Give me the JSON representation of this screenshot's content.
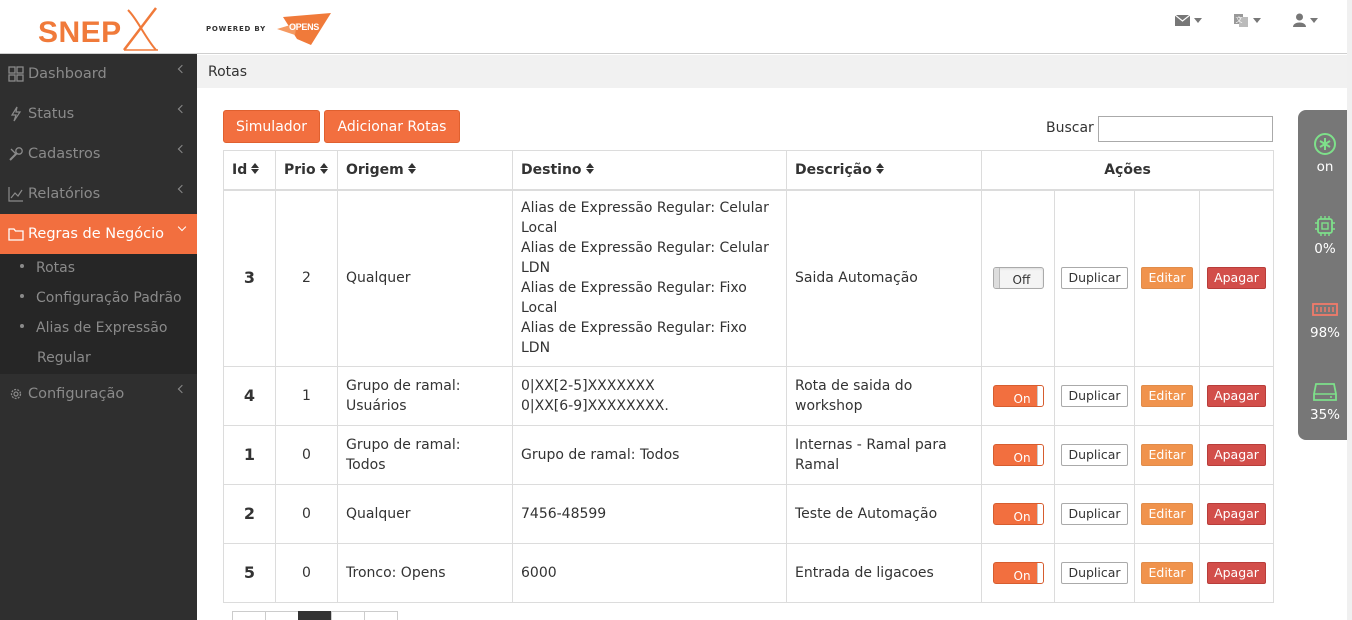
{
  "brand": {
    "name": "SNEP",
    "powered_by": "POWERED BY",
    "partner": "OPENS",
    "accent": "#f26f3f"
  },
  "topbar": {
    "icons": [
      "envelope-icon",
      "language-icon",
      "user-icon"
    ]
  },
  "sidebar": {
    "items": [
      {
        "label": "Dashboard",
        "icon": "dashboard-icon"
      },
      {
        "label": "Status",
        "icon": "bolt-icon"
      },
      {
        "label": "Cadastros",
        "icon": "tools-icon"
      },
      {
        "label": "Relatórios",
        "icon": "chart-icon"
      },
      {
        "label": "Regras de Negócio",
        "icon": "folder-icon"
      },
      {
        "label": "Configuração",
        "icon": "gear-icon"
      }
    ],
    "subitems": [
      "Rotas",
      "Configuração Padrão",
      "Alias de Expressão",
      "Regular"
    ]
  },
  "breadcrumb": "Rotas",
  "toolbar": {
    "simulator_label": "Simulador",
    "add_label": "Adicionar Rotas",
    "search_label": "Buscar",
    "search_value": ""
  },
  "table": {
    "headers": {
      "id": "Id",
      "prio": "Prio",
      "origem": "Origem",
      "destino": "Destino",
      "descricao": "Descrição",
      "acoes": "Ações"
    },
    "actions": {
      "duplicate": "Duplicar",
      "edit": "Editar",
      "delete": "Apagar"
    },
    "rows": [
      {
        "id": "3",
        "prio": "2",
        "origem": "Qualquer",
        "destino": [
          "Alias de Expressão Regular: Celular",
          "Local",
          "Alias de Expressão Regular: Celular",
          "LDN",
          "Alias de Expressão Regular: Fixo",
          "Local",
          "Alias de Expressão Regular: Fixo",
          "LDN"
        ],
        "descricao": "Saida Automação",
        "status": "Off"
      },
      {
        "id": "4",
        "prio": "1",
        "origem": "Grupo de ramal: Usuários",
        "destino": [
          "0|XX[2-5]XXXXXXX",
          "0|XX[6-9]XXXXXXXX."
        ],
        "descricao": "Rota de saida do workshop",
        "status": "On"
      },
      {
        "id": "1",
        "prio": "0",
        "origem": "Grupo de ramal: Todos",
        "destino": [
          "Grupo de ramal: Todos"
        ],
        "descricao": "Internas - Ramal para Ramal",
        "status": "On"
      },
      {
        "id": "2",
        "prio": "0",
        "origem": "Qualquer",
        "destino": [
          "7456-48599"
        ],
        "descricao": "Teste de Automação",
        "status": "On"
      },
      {
        "id": "5",
        "prio": "0",
        "origem": "Tronco: Opens",
        "destino": [
          "6000"
        ],
        "descricao": "Entrada de ligacoes",
        "status": "On"
      }
    ]
  },
  "widgets": [
    {
      "icon": "asterisk-icon",
      "value": "on"
    },
    {
      "icon": "cpu-icon",
      "value": "0%"
    },
    {
      "icon": "memory-icon",
      "value": "98%"
    },
    {
      "icon": "disk-icon",
      "value": "35%"
    }
  ]
}
